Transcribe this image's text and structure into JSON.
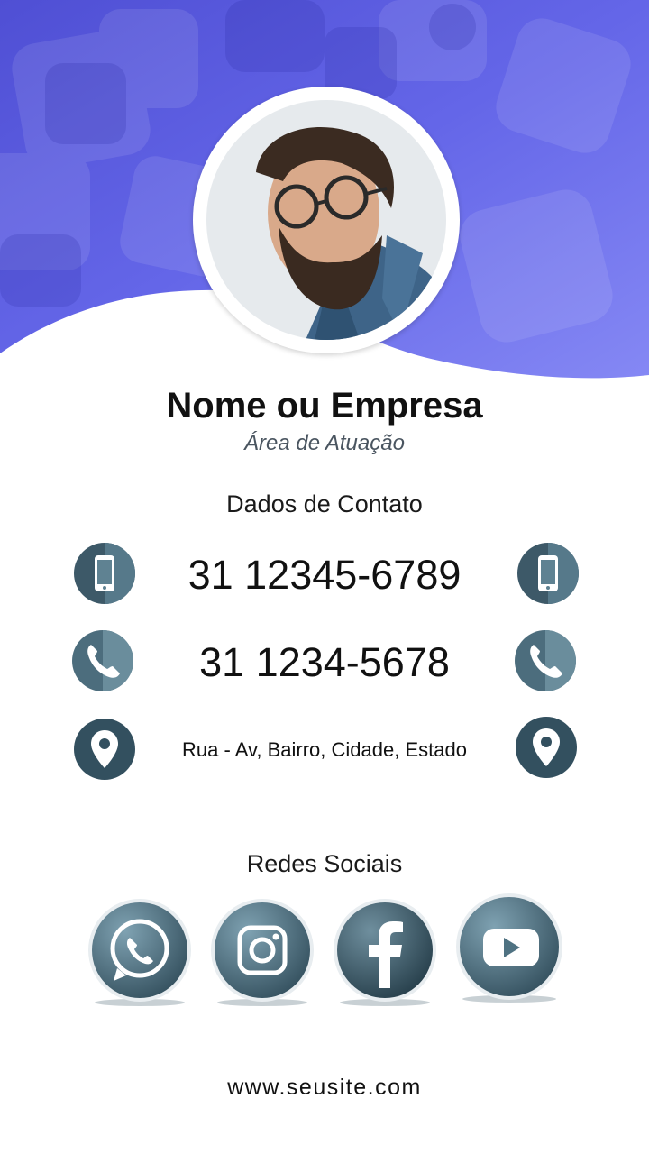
{
  "card": {
    "name": "Nome ou Empresa",
    "area": "Área de Atuação",
    "contact_title": "Dados de Contato",
    "mobile": "31 12345-6789",
    "phone": "31 1234-5678",
    "address": "Rua - Av, Bairro, Cidade, Estado",
    "social_title": "Redes Sociais",
    "social": [
      "whatsapp-icon",
      "instagram-icon",
      "facebook-icon",
      "youtube-icon"
    ],
    "website": "www.seusite.com"
  },
  "colors": {
    "header_purple": "#5b5ee6",
    "header_light": "#7c7ff2",
    "icon_teal": "#3d5968",
    "icon_teal_light": "#5f8292"
  }
}
